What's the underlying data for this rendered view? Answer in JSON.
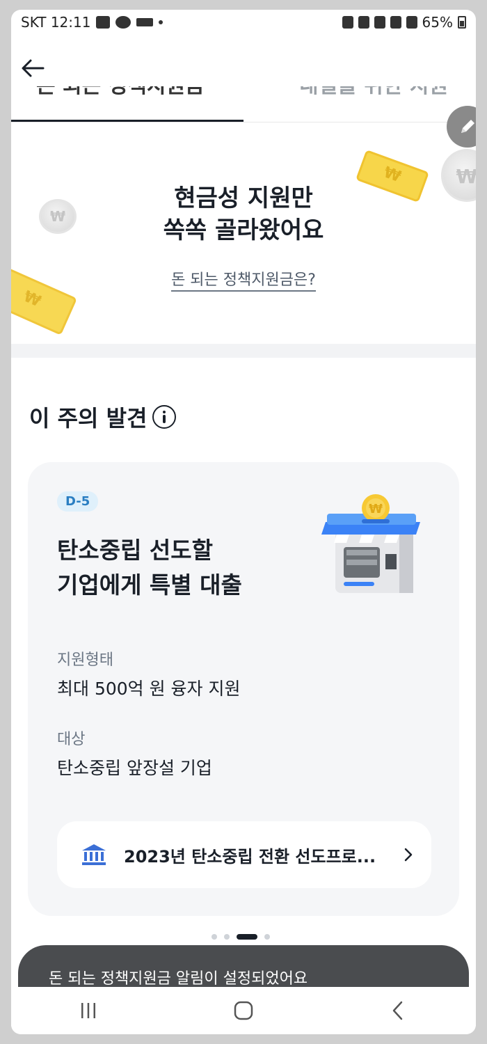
{
  "status_bar": {
    "carrier_time": "SKT 12:11",
    "battery": "65%"
  },
  "tabs": [
    {
      "label": "돈 되는 정책지원금"
    },
    {
      "label": "내일을 위한 지원"
    }
  ],
  "hero": {
    "title_line1": "현금성 지원만",
    "title_line2": "쏙쏙 골라왔어요",
    "link": "돈 되는 정책지원금은?"
  },
  "section": {
    "title": "이 주의 발견"
  },
  "card": {
    "dday": "D-5",
    "title_line1": "탄소중립 선도할",
    "title_line2": "기업에게 특별 대출",
    "support_type_label": "지원형태",
    "support_type_value": "최대 500억 원 융자 지원",
    "target_label": "대상",
    "target_value": "탄소중립 앞장설 기업",
    "program_label": "2023년 탄소중립 전환 선도프로..."
  },
  "pager": {
    "count": 4,
    "active_index": 2
  },
  "toast": {
    "message": "돈 되는 정책지원금 알림이 설정되었어요"
  },
  "colors": {
    "accent_blue": "#3b82f6",
    "dday_bg": "#dff0fb",
    "dday_text": "#2a7ec2",
    "toast_bg": "#4a4c4f",
    "card_bg": "#f5f6f8"
  },
  "icons": [
    "back-arrow-icon",
    "edit-pencil-icon",
    "info-icon",
    "bank-icon",
    "chevron-right-icon",
    "recent-apps-icon",
    "home-icon",
    "nav-back-icon"
  ]
}
